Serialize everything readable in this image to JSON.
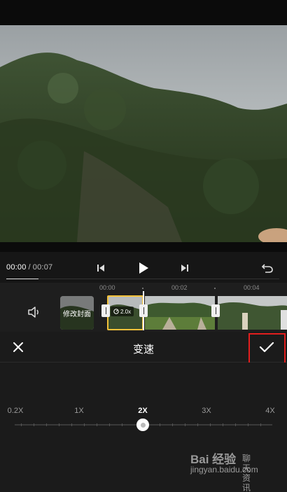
{
  "player": {
    "current_time": "00:00",
    "separator": "/",
    "total_time": "00:07"
  },
  "timeline": {
    "ruler": [
      "00:00",
      "00:02",
      "00:04"
    ],
    "cover_label": "修改封面",
    "clip_speed_badge": "2.0x"
  },
  "panel": {
    "title": "变速",
    "close_icon": "close-icon",
    "confirm_icon": "check-icon"
  },
  "speed": {
    "options": [
      "0.2X",
      "1X",
      "2X",
      "3X",
      "4X"
    ],
    "selected": "2X"
  },
  "watermark": {
    "line1": "Bai 经验",
    "line2": "jingyan.baidu.com",
    "line3": "聊天资讯"
  },
  "colors": {
    "highlight_box": "#e21e1e",
    "selected_clip_border": "#f2c13a",
    "background": "#1b1b1b"
  }
}
